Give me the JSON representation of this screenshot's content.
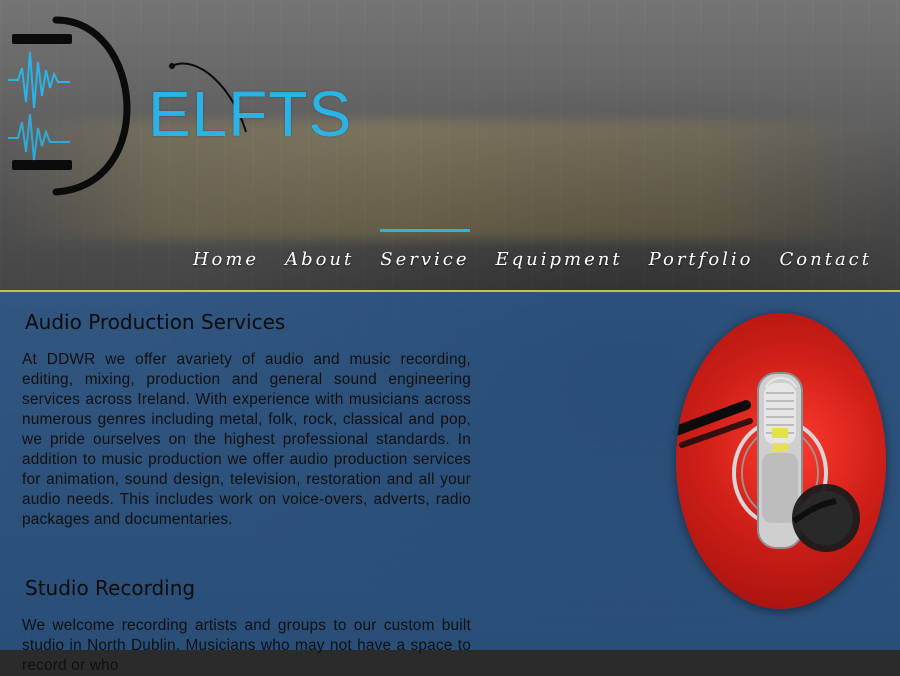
{
  "brand": {
    "logo_text": "ELFTS",
    "accent": "#29b3e6",
    "divider_color": "#c8d36a",
    "panel_color": "#285c96"
  },
  "nav": {
    "items": [
      {
        "label": "Home",
        "active": false
      },
      {
        "label": "About",
        "active": false
      },
      {
        "label": "Service",
        "active": true
      },
      {
        "label": "Equipment",
        "active": false
      },
      {
        "label": "Portfolio",
        "active": false
      },
      {
        "label": "Contact",
        "active": false
      }
    ]
  },
  "sections": [
    {
      "title": "Audio Production Services",
      "body": "At DDWR we offer avariety of audio and music recording, editing, mixing, production and general sound engineering services across Ireland. With experience with musicians across numerous genres including metal, folk, rock, classical and pop, we pride ourselves on the highest professional standards. In addition to music production we offer audio production services for animation, sound design, television, restoration and all your audio needs. This includes work on voice-overs, adverts, radio packages and documentaries."
    },
    {
      "title": "Studio Recording",
      "body": "We welcome recording artists and groups to our custom built studio in North Dublin. Musicians who may not have a space to record or who"
    }
  ],
  "images": {
    "mic_circle": {
      "icon": "studio-microphone-photo"
    }
  }
}
